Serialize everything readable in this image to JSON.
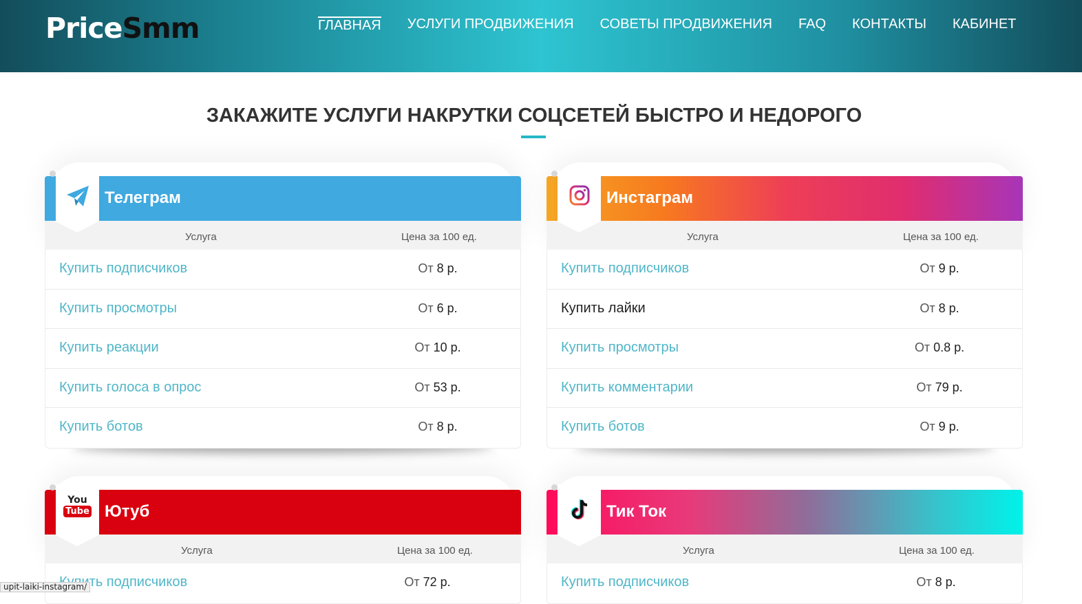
{
  "header": {
    "logo_part1": "Price",
    "logo_part2": "Smm",
    "nav": [
      "ГЛАВНАЯ",
      "УСЛУГИ ПРОДВИЖЕНИЯ",
      "СОВЕТЫ ПРОДВИЖЕНИЯ",
      "FAQ",
      "КОНТАКТЫ",
      "КАБИНЕТ"
    ]
  },
  "page_title": "ЗАКАЖИТЕ УСЛУГИ НАКРУТКИ СОЦСЕТЕЙ БЫСТРО И НЕДОРОГО",
  "columns": {
    "service": "Услуга",
    "price": "Цена за 100 ед."
  },
  "price_prefix": "От",
  "cards": [
    {
      "title": "Телеграм",
      "icon": "telegram-icon",
      "rows": [
        {
          "service": "Купить подписчиков",
          "price": "8 р."
        },
        {
          "service": "Купить просмотры",
          "price": "6 р."
        },
        {
          "service": "Купить реакции",
          "price": "10 р."
        },
        {
          "service": "Купить голоса в опрос",
          "price": "53 р."
        },
        {
          "service": "Купить ботов",
          "price": "8 р."
        }
      ]
    },
    {
      "title": "Инстаграм",
      "icon": "instagram-icon",
      "rows": [
        {
          "service": "Купить подписчиков",
          "price": "9 р."
        },
        {
          "service": "Купить лайки",
          "price": "8 р."
        },
        {
          "service": "Купить просмотры",
          "price": "0.8 р."
        },
        {
          "service": "Купить комментарии",
          "price": "79 р."
        },
        {
          "service": "Купить ботов",
          "price": "9 р."
        }
      ]
    },
    {
      "title": "Ютуб",
      "icon": "youtube-icon",
      "icon_text_top": "You",
      "icon_text_bottom": "Tube",
      "rows": [
        {
          "service": "Купить подписчиков",
          "price": "72 р."
        }
      ]
    },
    {
      "title": "Тик Ток",
      "icon": "tiktok-icon",
      "rows": [
        {
          "service": "Купить подписчиков",
          "price": "8 р."
        }
      ]
    }
  ],
  "status_bar": "upit-laiki-instagram/",
  "colors": {
    "accent": "#26b7c6",
    "link": "#4fb6c8",
    "telegram": "#3fa9e0",
    "youtube": "#d9000f"
  }
}
